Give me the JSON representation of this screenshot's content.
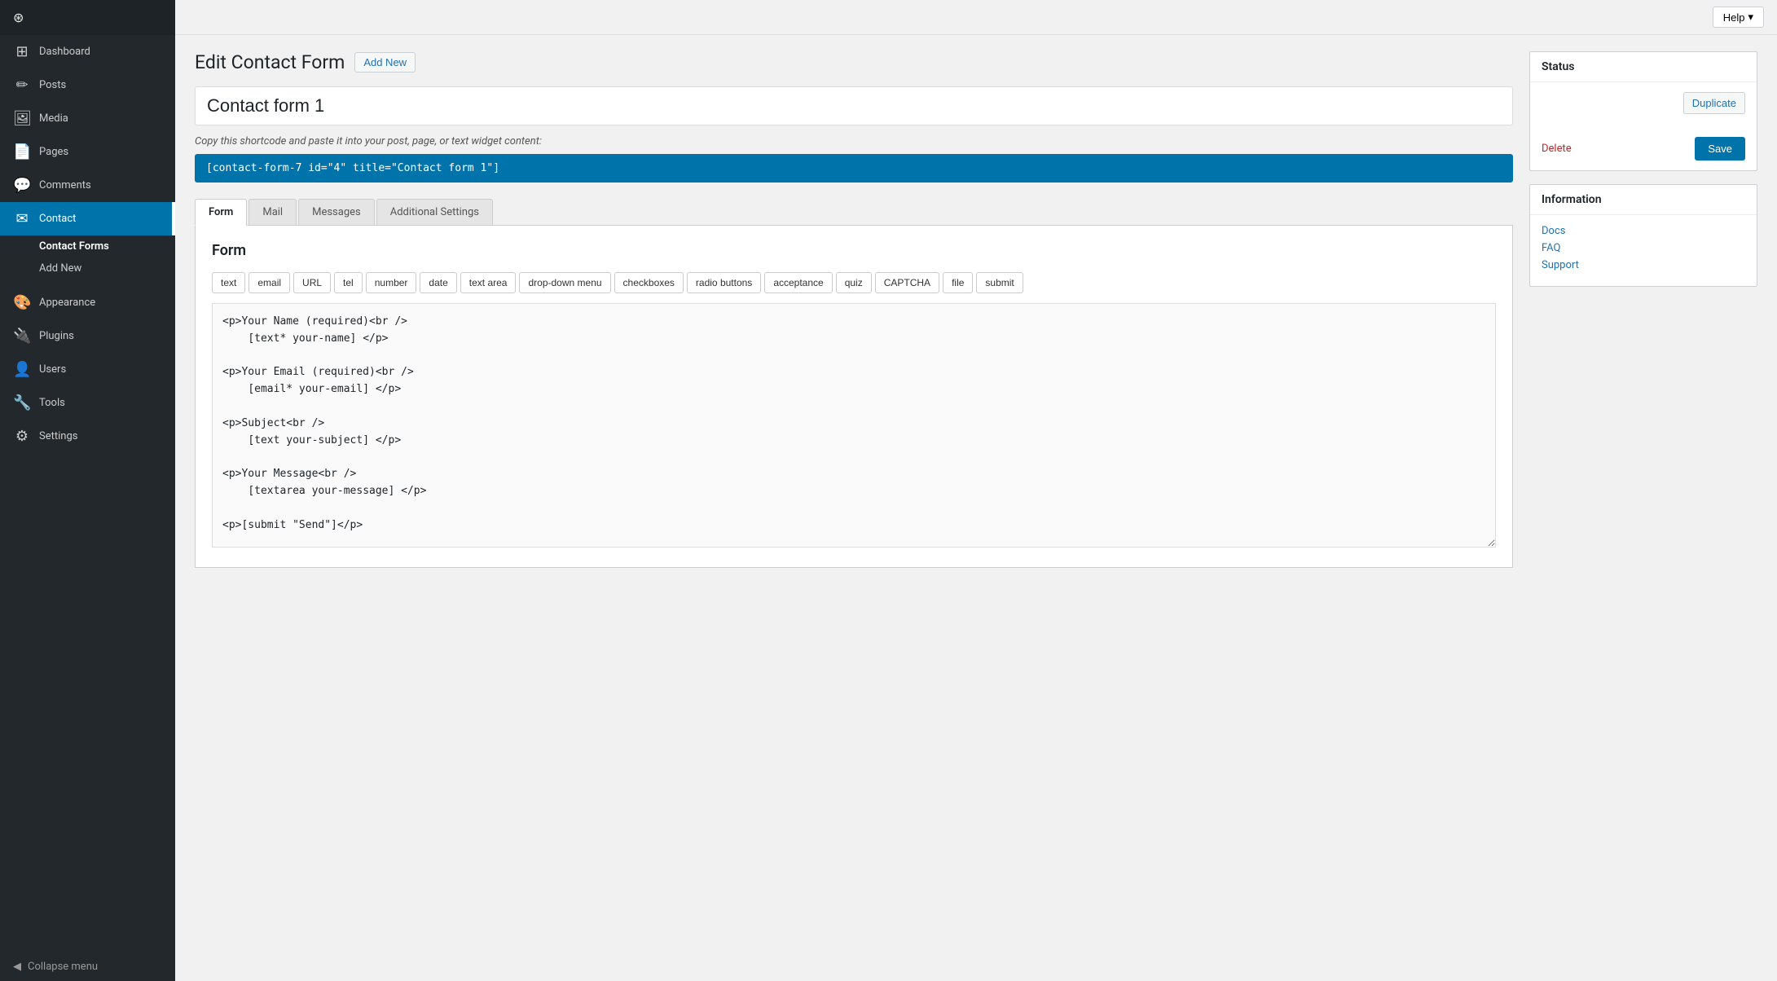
{
  "sidebar": {
    "items": [
      {
        "id": "dashboard",
        "label": "Dashboard",
        "icon": "⊞"
      },
      {
        "id": "posts",
        "label": "Posts",
        "icon": "📝"
      },
      {
        "id": "media",
        "label": "Media",
        "icon": "🖼"
      },
      {
        "id": "pages",
        "label": "Pages",
        "icon": "📄"
      },
      {
        "id": "comments",
        "label": "Comments",
        "icon": "💬"
      },
      {
        "id": "contact",
        "label": "Contact",
        "icon": "✉",
        "active": true
      }
    ],
    "contact_sub": [
      {
        "id": "contact-forms",
        "label": "Contact Forms",
        "active": true
      },
      {
        "id": "add-new",
        "label": "Add New"
      }
    ],
    "bottom_items": [
      {
        "id": "appearance",
        "label": "Appearance",
        "icon": "🎨"
      },
      {
        "id": "plugins",
        "label": "Plugins",
        "icon": "🔌"
      },
      {
        "id": "users",
        "label": "Users",
        "icon": "👤"
      },
      {
        "id": "tools",
        "label": "Tools",
        "icon": "🔧"
      },
      {
        "id": "settings",
        "label": "Settings",
        "icon": "⚙"
      }
    ],
    "collapse_label": "Collapse menu"
  },
  "topbar": {
    "help_label": "Help"
  },
  "page": {
    "title": "Edit Contact Form",
    "add_new_label": "Add New",
    "form_name": "Contact form 1",
    "shortcode_hint": "Copy this shortcode and paste it into your post, page, or text widget content:",
    "shortcode_value": "[contact-form-7 id=\"4\" title=\"Contact form 1\"]"
  },
  "tabs": [
    {
      "id": "form",
      "label": "Form",
      "active": true
    },
    {
      "id": "mail",
      "label": "Mail"
    },
    {
      "id": "messages",
      "label": "Messages"
    },
    {
      "id": "additional-settings",
      "label": "Additional Settings"
    }
  ],
  "form_editor": {
    "title": "Form",
    "tag_buttons": [
      "text",
      "email",
      "URL",
      "tel",
      "number",
      "date",
      "text area",
      "drop-down menu",
      "checkboxes",
      "radio buttons",
      "acceptance",
      "quiz",
      "CAPTCHA",
      "file",
      "submit"
    ],
    "code_content": "<p>Your Name (required)<br />\n    [text* your-name] </p>\n\n<p>Your Email (required)<br />\n    [email* your-email] </p>\n\n<p>Subject<br />\n    [text your-subject] </p>\n\n<p>Your Message<br />\n    [textarea your-message] </p>\n\n<p>[submit \"Send\"]</p>"
  },
  "status_panel": {
    "title": "Status",
    "duplicate_label": "Duplicate",
    "delete_label": "Delete",
    "save_label": "Save"
  },
  "information_panel": {
    "title": "Information",
    "links": [
      {
        "id": "docs",
        "label": "Docs"
      },
      {
        "id": "faq",
        "label": "FAQ"
      },
      {
        "id": "support",
        "label": "Support"
      }
    ]
  }
}
